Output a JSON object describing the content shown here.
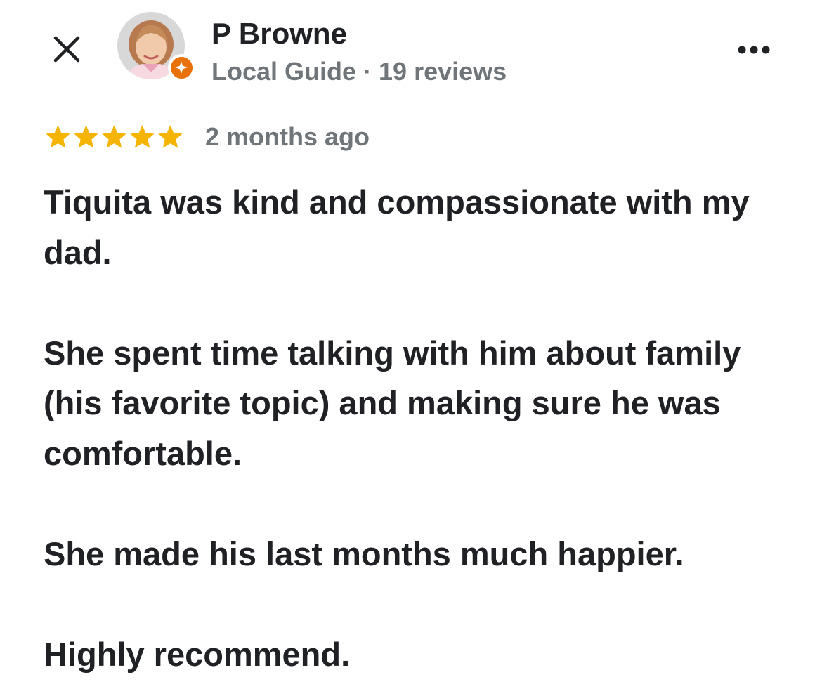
{
  "review": {
    "reviewer_name": "P Browne",
    "reviewer_meta": "Local Guide · 19 reviews",
    "rating": 5,
    "rating_max": 5,
    "date": "2 months ago",
    "paragraphs": [
      "Tiquita was kind and compassionate with my dad.",
      "She spent time talking with him about family (his favorite topic) and making sure he was comfortable.",
      "She made his last months much happier.",
      "Highly recommend."
    ]
  },
  "icons": {
    "close": "close-icon",
    "more": "more-options-icon",
    "star": "star-icon",
    "badge": "local-guide-badge-icon"
  },
  "colors": {
    "star": "#f4b400",
    "badge": "#e8710a",
    "text_primary": "#202124",
    "text_secondary": "#70757a"
  }
}
